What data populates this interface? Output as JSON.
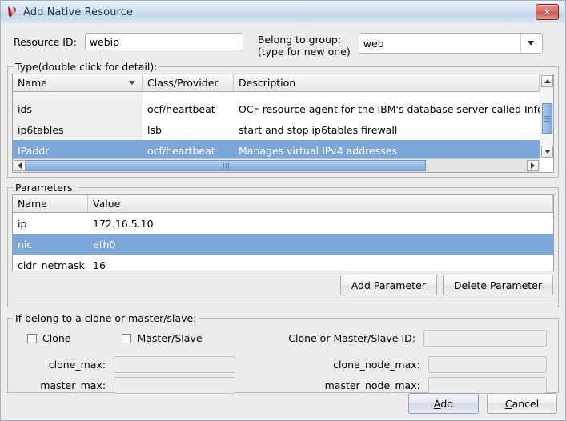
{
  "window": {
    "title": "Add Native Resource",
    "icon": "app-logo-icon",
    "close_label": "✕"
  },
  "form": {
    "resource_id_label": "Resource ID:",
    "resource_id_value": "webip",
    "group_label_line1": "Belong to group:",
    "group_label_line2": "(type for new one)",
    "group_value": "web"
  },
  "type_section": {
    "title": "Type(double click for detail):",
    "columns": [
      "Name",
      "Class/Provider",
      "Description"
    ],
    "rows": [
      {
        "name": "",
        "class": "",
        "description": "",
        "selected": false,
        "clipped": "top"
      },
      {
        "name": "ids",
        "class": "ocf/heartbeat",
        "description": "OCF resource agent for the IBM's database server called Infor",
        "selected": false
      },
      {
        "name": "ip6tables",
        "class": "lsb",
        "description": " start and stop ip6tables firewall",
        "selected": false
      },
      {
        "name": "IPaddr",
        "class": "ocf/heartbeat",
        "description": "Manages virtual IPv4 addresses",
        "selected": true
      },
      {
        "name": "",
        "class": "",
        "description": "",
        "selected": false,
        "clipped": "bottom"
      }
    ]
  },
  "parameters_section": {
    "title": "Parameters:",
    "columns": [
      "Name",
      "Value"
    ],
    "rows": [
      {
        "name": "ip",
        "value": "172.16.5.10",
        "selected": false
      },
      {
        "name": "nic",
        "value": "eth0",
        "selected": true
      },
      {
        "name": "cidr_netmask",
        "value": "16",
        "selected": false
      }
    ],
    "add_button": "Add Parameter",
    "delete_button": "Delete Parameter"
  },
  "clone_section": {
    "title": "If belong to a clone or master/slave:",
    "clone_checkbox_label": "Clone",
    "clone_checked": false,
    "master_slave_checkbox_label": "Master/Slave",
    "master_slave_checked": false,
    "clone_id_label": "Clone or Master/Slave ID:",
    "clone_id_value": "",
    "clone_max_label": "clone_max:",
    "clone_max_value": "",
    "clone_node_max_label": "clone_node_max:",
    "clone_node_max_value": "",
    "master_max_label": "master_max:",
    "master_max_value": "",
    "master_node_max_label": "master_node_max:",
    "master_node_max_value": ""
  },
  "footer": {
    "add_mnemonic": "A",
    "add_rest": "dd",
    "cancel_mnemonic": "C",
    "cancel_rest": "ancel"
  },
  "colors": {
    "selection_blue": "#7da7d9",
    "titlebar_top": "#eaf1f8",
    "titlebar_bottom": "#c3d7ea",
    "panel_bg": "#ececec",
    "close_red": "#c75a52"
  }
}
